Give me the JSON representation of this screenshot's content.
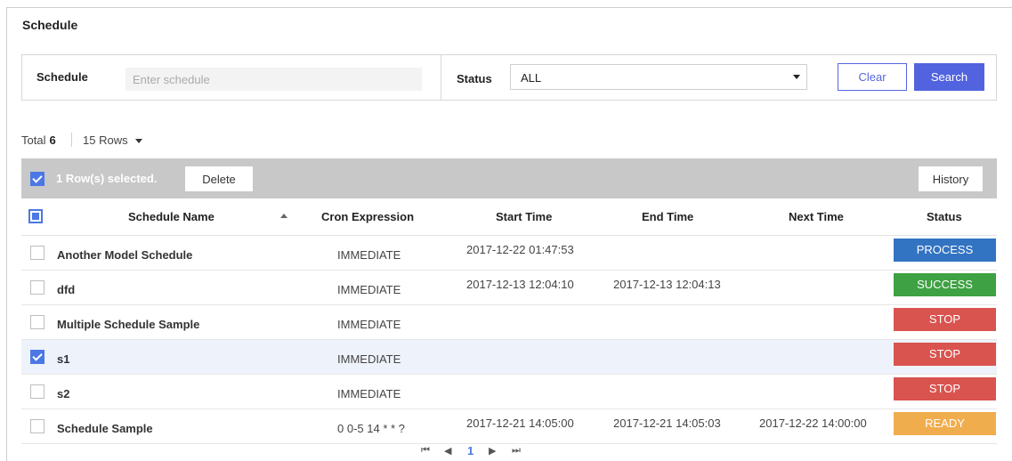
{
  "page": {
    "title": "Schedule"
  },
  "filters": {
    "schedule_label": "Schedule",
    "schedule_placeholder": "Enter schedule",
    "schedule_value": "",
    "status_label": "Status",
    "status_value": "ALL",
    "clear_label": "Clear",
    "search_label": "Search"
  },
  "summary": {
    "total_label": "Total",
    "total_count": "6",
    "rows_per_page": "15 Rows"
  },
  "action_bar": {
    "selected_text": "1 Row(s) selected.",
    "delete_label": "Delete",
    "history_label": "History"
  },
  "table": {
    "columns": [
      "Schedule Name",
      "Cron Expression",
      "Start Time",
      "End Time",
      "Next Time",
      "Status"
    ],
    "rows": [
      {
        "name": "Another Model Schedule",
        "cron": "IMMEDIATE",
        "start": "2017-12-22 01:47:53",
        "end": "",
        "next": "",
        "status": "PROCESS",
        "checked": false
      },
      {
        "name": "dfd",
        "cron": "IMMEDIATE",
        "start": "2017-12-13 12:04:10",
        "end": "2017-12-13 12:04:13",
        "next": "",
        "status": "SUCCESS",
        "checked": false
      },
      {
        "name": "Multiple Schedule Sample",
        "cron": "IMMEDIATE",
        "start": "",
        "end": "",
        "next": "",
        "status": "STOP",
        "checked": false
      },
      {
        "name": "s1",
        "cron": "IMMEDIATE",
        "start": "",
        "end": "",
        "next": "",
        "status": "STOP",
        "checked": true
      },
      {
        "name": "s2",
        "cron": "IMMEDIATE",
        "start": "",
        "end": "",
        "next": "",
        "status": "STOP",
        "checked": false
      },
      {
        "name": "Schedule Sample",
        "cron": "0 0-5 14 * * ?",
        "start": "2017-12-21 14:05:00",
        "end": "2017-12-21 14:05:03",
        "next": "2017-12-22 14:00:00",
        "status": "READY",
        "checked": false
      }
    ]
  },
  "status_colors": {
    "PROCESS": "#3273c2",
    "SUCCESS": "#3ea143",
    "STOP": "#d9534f",
    "READY": "#f0ad4e"
  },
  "accent_color": "#5263e0",
  "pagination": {
    "first": "⏮",
    "prev": "◀",
    "current_page": "1",
    "next": "▶",
    "last": "⏭"
  }
}
